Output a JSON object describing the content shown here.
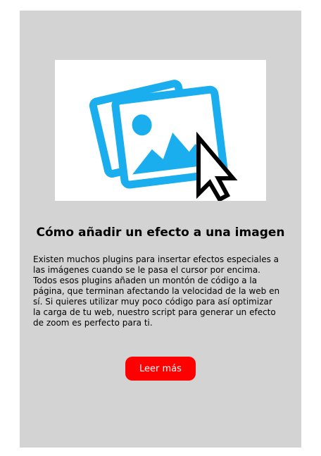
{
  "card": {
    "title": "Cómo añadir un efecto a una imagen",
    "description": "Existen muchos plugins para insertar efectos especiales a las imágenes cuando se le pasa el cursor por encima. Todos esos plugins añaden un montón de código a la página, que terminan afectando la velocidad de la web en sí. Si quieres utilizar muy poco código para así optimizar la carga de tu web, nuestro script para generar un efecto de zoom es perfecto para ti.",
    "button_label": "Leer más",
    "image_icon": "photo-gallery-with-cursor-icon"
  },
  "colors": {
    "card_background": "#d3d3d3",
    "icon_accent": "#1aaeee",
    "button_background": "#ff0000",
    "button_text": "#ffffff"
  }
}
